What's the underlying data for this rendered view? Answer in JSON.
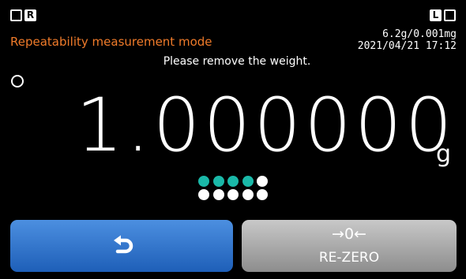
{
  "status_bar": {
    "left_indicator_letter": "R",
    "right_indicator_letter": "L"
  },
  "header": {
    "mode_title": "Repeatability measurement mode",
    "capacity": "6.2g/0.001mg",
    "datetime": "2021/04/21  17:12",
    "accent_color": "#f07b2a"
  },
  "instruction": "Please remove the weight.",
  "stability_icon": "stable-circle-icon",
  "reading": {
    "value": "1.000000",
    "unit": "g"
  },
  "progress": {
    "completed": 4,
    "total": 10,
    "done_color": "#1ab8a8",
    "pending_color": "#ffffff"
  },
  "buttons": {
    "back_icon": "return-arrow-icon",
    "rezero_symbol": "→0←",
    "rezero_label": "RE-ZERO"
  }
}
